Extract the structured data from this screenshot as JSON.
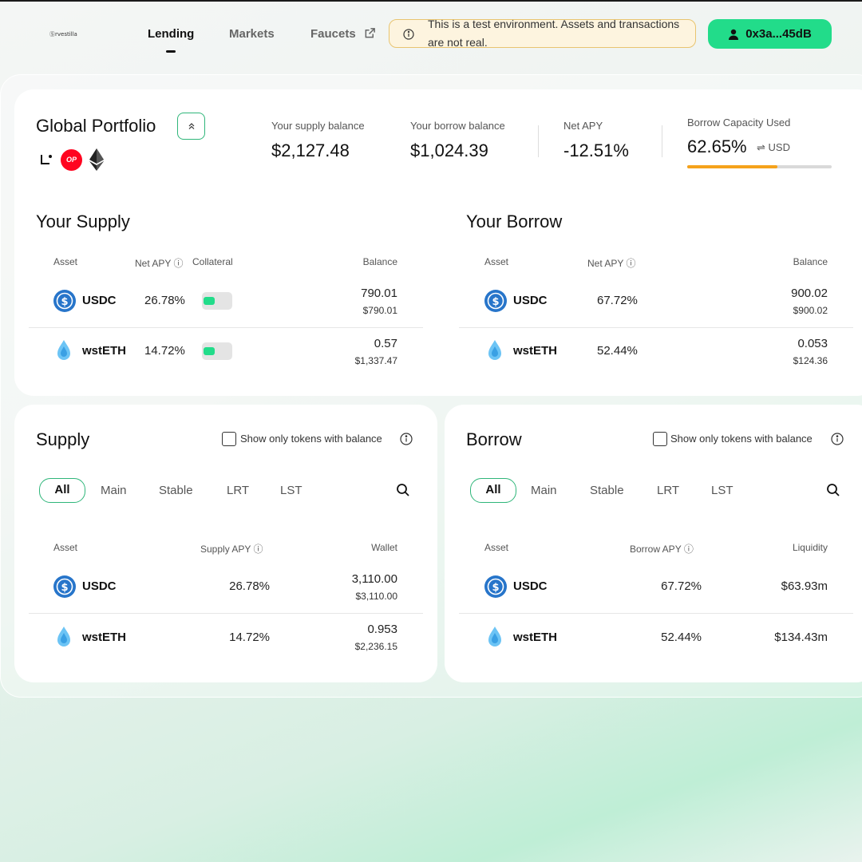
{
  "header": {
    "logo_text": "Ⓢrvestilla",
    "nav": {
      "lending": "Lending",
      "markets": "Markets",
      "faucets": "Faucets"
    },
    "banner_text": "This is a test environment. Assets and transactions are not real.",
    "wallet_label": "0x3a...45dB"
  },
  "portfolio": {
    "title": "Global Portfolio",
    "networks": [
      "linea-icon",
      "optimism-icon",
      "ethereum-icon"
    ],
    "op_badge": "OP",
    "supply_balance_label": "Your supply balance",
    "supply_balance": "$2,127.48",
    "borrow_balance_label": "Your borrow balance",
    "borrow_balance": "$1,024.39",
    "net_apy_label": "Net APY",
    "net_apy": "-12.51%",
    "capacity_label": "Borrow Capacity Used",
    "capacity_value": "62.65%",
    "capacity_unit": "USD",
    "capacity_fraction": 0.6265,
    "colors": {
      "accent": "#22dc8a",
      "progress": "#f5a21b",
      "banner_border": "#e8c470"
    }
  },
  "your_supply": {
    "title": "Your Supply",
    "headers": {
      "asset": "Asset",
      "net_apy": "Net APY",
      "collateral": "Collateral",
      "balance": "Balance"
    },
    "rows": [
      {
        "asset": "USDC",
        "apy": "26.78%",
        "balance": "790.01",
        "balance_usd": "$790.01"
      },
      {
        "asset": "wstETH",
        "apy": "14.72%",
        "balance": "0.57",
        "balance_usd": "$1,337.47"
      }
    ]
  },
  "your_borrow": {
    "title": "Your Borrow",
    "headers": {
      "asset": "Asset",
      "net_apy": "Net APY",
      "balance": "Balance"
    },
    "rows": [
      {
        "asset": "USDC",
        "apy": "67.72%",
        "balance": "900.02",
        "balance_usd": "$900.02"
      },
      {
        "asset": "wstETH",
        "apy": "52.44%",
        "balance": "0.053",
        "balance_usd": "$124.36"
      }
    ]
  },
  "supply": {
    "title": "Supply",
    "checkbox_label": "Show only tokens with balance",
    "tabs": [
      "All",
      "Main",
      "Stable",
      "LRT",
      "LST"
    ],
    "headers": {
      "asset": "Asset",
      "apy": "Supply APY",
      "wallet": "Wallet"
    },
    "rows": [
      {
        "asset": "USDC",
        "apy": "26.78%",
        "wallet": "3,110.00",
        "wallet_usd": "$3,110.00"
      },
      {
        "asset": "wstETH",
        "apy": "14.72%",
        "wallet": "0.953",
        "wallet_usd": "$2,236.15"
      }
    ]
  },
  "borrow": {
    "title": "Borrow",
    "checkbox_label": "Show only tokens with balance",
    "tabs": [
      "All",
      "Main",
      "Stable",
      "LRT",
      "LST"
    ],
    "headers": {
      "asset": "Asset",
      "apy": "Borrow APY",
      "liquidity": "Liquidity"
    },
    "rows": [
      {
        "asset": "USDC",
        "apy": "67.72%",
        "liquidity": "$63.93m"
      },
      {
        "asset": "wstETH",
        "apy": "52.44%",
        "liquidity": "$134.43m"
      }
    ]
  }
}
